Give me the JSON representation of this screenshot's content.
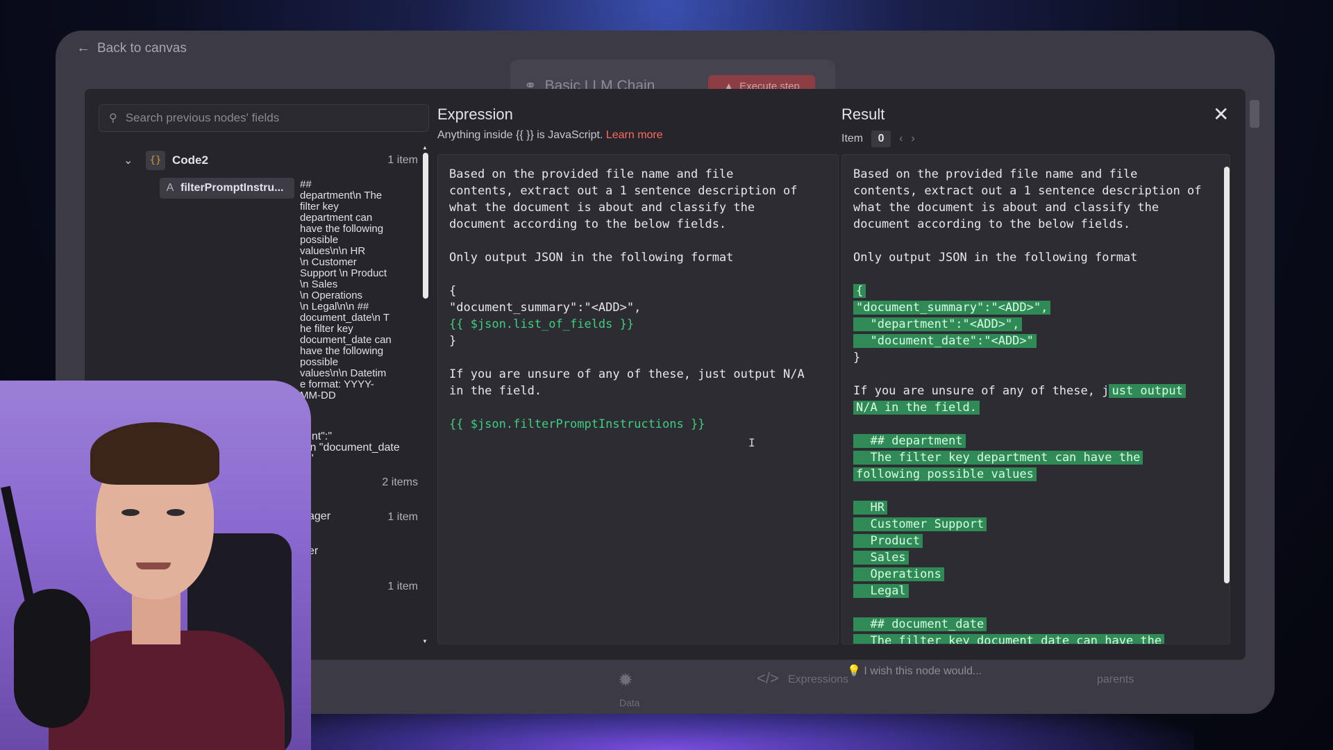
{
  "app": {
    "back_label": "Back to canvas",
    "node_title": "Basic LLM Chain",
    "execute_label": "Execute step",
    "bottom": {
      "data_label": "Data",
      "expressions_label": "Expressions",
      "wish_label": "I wish this node would...",
      "parents_label": "parents"
    }
  },
  "sidebar": {
    "search_placeholder": "Search previous nodes' fields",
    "nodes": [
      {
        "name": "Code2",
        "count": "1 item"
      },
      {
        "count": "2 items"
      },
      {
        "name_fragment": "ager",
        "count": "1 item"
      },
      {
        "name_fragment": "er"
      },
      {
        "count": "1 item"
      }
    ],
    "field": {
      "type_letter": "A",
      "name": "filterPromptInstru...",
      "value": "##\ndepartment\\n The\nfilter key\ndepartment can\nhave the following\npossible\nvalues\\n\\n HR\n\\n Customer\nSupport \\n Product\n\\n Sales\n\\n Operations\n\\n Legal\\n\\n ##\ndocument_date\\n T\nhe filter key\ndocument_date can\nhave the following\npossible\nvalues\\n\\n Datetim\ne format: YYYY-\nMM-DD"
    },
    "fragments": [
      "ent\":\"",
      "\\n \"document_date",
      "\""
    ]
  },
  "expression": {
    "title": "Expression",
    "subtitle_prefix": "Anything inside ",
    "subtitle_braces": "{{ }}",
    "subtitle_mid": " is JavaScript. ",
    "learn_more": "Learn more",
    "lines": [
      {
        "text": "Based on the provided file name and file",
        "type": "text"
      },
      {
        "text": "contents, extract out a 1 sentence description of",
        "type": "text"
      },
      {
        "text": "what the document is about and classify the",
        "type": "text"
      },
      {
        "text": "document according to the below fields.",
        "type": "text"
      },
      {
        "text": "",
        "type": "text"
      },
      {
        "text": "Only output JSON in the following format",
        "type": "text"
      },
      {
        "text": "",
        "type": "text"
      },
      {
        "text": "{",
        "type": "text"
      },
      {
        "text": "\"document_summary\":\"<ADD>\",",
        "type": "text"
      },
      {
        "text": "{{ $json.list_of_fields }}",
        "type": "expr"
      },
      {
        "text": "}",
        "type": "text"
      },
      {
        "text": "",
        "type": "text"
      },
      {
        "text": "If you are unsure of any of these, just output N/A",
        "type": "text"
      },
      {
        "text": "in the field.",
        "type": "text"
      },
      {
        "text": "",
        "type": "text"
      },
      {
        "text": "{{ $json.filterPromptInstructions }}",
        "type": "expr"
      }
    ]
  },
  "result": {
    "title": "Result",
    "item_label": "Item",
    "item_index": "0",
    "lines": [
      {
        "text": "Based on the provided file name and file",
        "hl": false
      },
      {
        "text": "contents, extract out a 1 sentence description of",
        "hl": false
      },
      {
        "text": "what the document is about and classify the",
        "hl": false
      },
      {
        "text": "document according to the below fields.",
        "hl": false
      },
      {
        "text": "",
        "hl": false
      },
      {
        "text": "Only output JSON in the following format",
        "hl": false
      },
      {
        "text": "",
        "hl": false
      },
      {
        "text": "{",
        "hl": true
      },
      {
        "text": "\"document_summary\":\"<ADD>\",",
        "hl": true
      },
      {
        "text": "  \"department\":\"<ADD>\",",
        "hl": true
      },
      {
        "text": "  \"document_date\":\"<ADD>\"",
        "hl": true
      },
      {
        "text": "}",
        "hl": false
      },
      {
        "text": "",
        "hl": false
      },
      {
        "text": "If you are unsure of any of these, j",
        "hl": false,
        "tail": "ust output"
      },
      {
        "text": "N/A in the field.",
        "hl": true
      },
      {
        "text": "",
        "hl": false
      },
      {
        "text": "  ## department",
        "hl": true
      },
      {
        "text": "  The filter key department can have the",
        "hl": true
      },
      {
        "text": "following possible values",
        "hl": true
      },
      {
        "text": "",
        "hl": false
      },
      {
        "text": "  HR",
        "hl": true
      },
      {
        "text": "  Customer Support",
        "hl": true
      },
      {
        "text": "  Product",
        "hl": true
      },
      {
        "text": "  Sales",
        "hl": true
      },
      {
        "text": "  Operations",
        "hl": true
      },
      {
        "text": "  Legal",
        "hl": true
      },
      {
        "text": "",
        "hl": false
      },
      {
        "text": "  ## document_date",
        "hl": true
      },
      {
        "text": "  The filter key document_date can have the",
        "hl": true
      }
    ]
  },
  "colors": {
    "accent": "#ff6d5a",
    "expression_green": "#3fcf7e",
    "highlight": "#2f8a55"
  },
  "icons": {
    "back": "arrow-left-icon",
    "search": "search-icon",
    "chevron": "chevron-down-icon",
    "code": "code-braces-icon",
    "close": "close-icon",
    "prev": "chevron-left-icon",
    "next": "chevron-right-icon"
  }
}
